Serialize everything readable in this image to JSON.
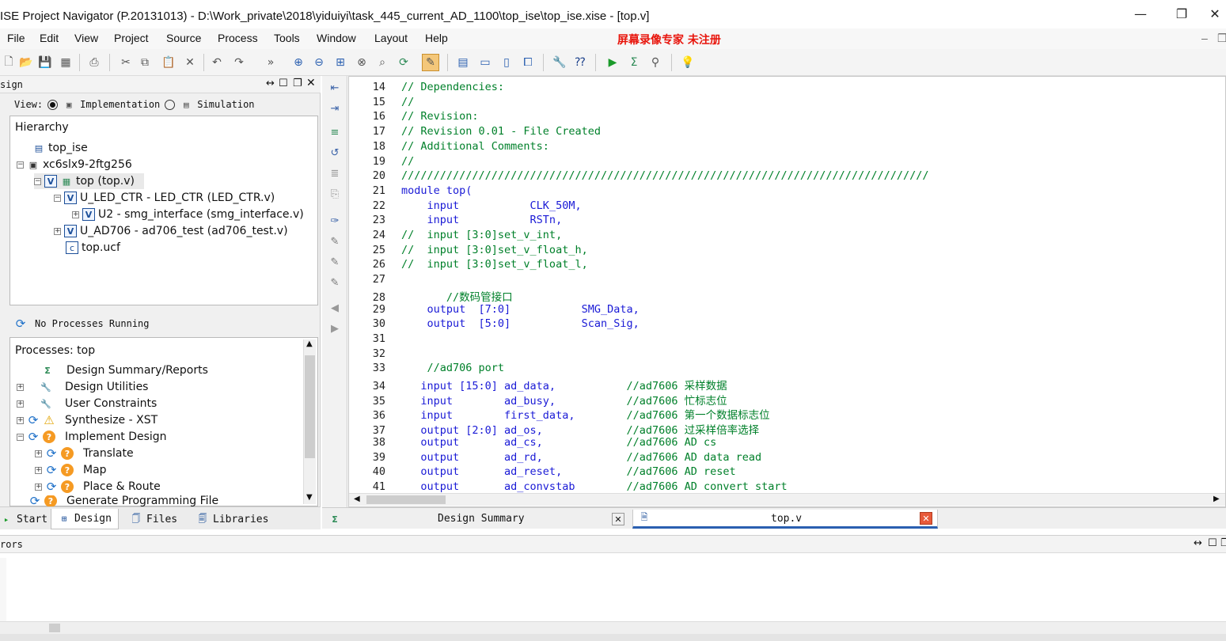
{
  "window": {
    "title": "ISE Project Navigator (P.20131013) - D:\\Work_private\\2018\\yiduiyi\\task_445_current_AD_1100\\top_ise\\top_ise.xise - [top.v]",
    "min": "—",
    "restore": "❐",
    "close": "✕"
  },
  "menu": {
    "items": [
      "File",
      "Edit",
      "View",
      "Project",
      "Source",
      "Process",
      "Tools",
      "Window",
      "Layout",
      "Help"
    ],
    "watermark": "屏幕录像专家  未注册"
  },
  "design_panel": {
    "title": "sign",
    "view_label": "View:",
    "impl_label": "Implementation",
    "sim_label": "Simulation",
    "hierarchy_label": "Hierarchy",
    "tree": [
      "top_ise",
      "xc6slx9-2ftg256",
      "top (top.v)",
      "U_LED_CTR - LED_CTR (LED_CTR.v)",
      "U2 - smg_interface (smg_interface.v)",
      "U_AD706 - ad706_test (ad706_test.v)",
      "top.ucf"
    ],
    "status": "No Processes Running",
    "processes_label": "Processes: top",
    "processes": [
      "Design Summary/Reports",
      "Design Utilities",
      "User Constraints",
      "Synthesize - XST",
      "Implement Design",
      "Translate",
      "Map",
      "Place & Route",
      "Generate Programming File"
    ]
  },
  "left_tabs": [
    "Start",
    "Design",
    "Files",
    "Libraries"
  ],
  "editor": {
    "lines": [
      {
        "n": "14",
        "t": "// Dependencies:"
      },
      {
        "n": "15",
        "t": "//"
      },
      {
        "n": "16",
        "t": "// Revision:"
      },
      {
        "n": "17",
        "t": "// Revision 0.01 - File Created"
      },
      {
        "n": "18",
        "t": "// Additional Comments:"
      },
      {
        "n": "19",
        "t": "//"
      },
      {
        "n": "20",
        "t": "//////////////////////////////////////////////////////////////////////////////////"
      },
      {
        "n": "21",
        "t": "module top("
      },
      {
        "n": "22",
        "t": "    input           CLK_50M,"
      },
      {
        "n": "23",
        "t": "    input           RSTn,"
      },
      {
        "n": "24",
        "t": "//  input [3:0]set_v_int,"
      },
      {
        "n": "25",
        "t": "//  input [3:0]set_v_float_h,"
      },
      {
        "n": "26",
        "t": "//  input [3:0]set_v_float_l,"
      },
      {
        "n": "27",
        "t": ""
      },
      {
        "n": "28",
        "t": "       //数码管接口"
      },
      {
        "n": "29",
        "t": "    output  [7:0]           SMG_Data,"
      },
      {
        "n": "30",
        "t": "    output  [5:0]           Scan_Sig,"
      },
      {
        "n": "31",
        "t": ""
      },
      {
        "n": "32",
        "t": ""
      },
      {
        "n": "33",
        "t": "    //ad706 port"
      },
      {
        "n": "34",
        "t": "   input [15:0] ad_data,           //ad7606 采样数据"
      },
      {
        "n": "35",
        "t": "   input        ad_busy,           //ad7606 忙标志位"
      },
      {
        "n": "36",
        "t": "   input        first_data,        //ad7606 第一个数据标志位"
      },
      {
        "n": "37",
        "t": "   output [2:0] ad_os,             //ad7606 过采样倍率选择"
      },
      {
        "n": "38",
        "t": "   output       ad_cs,             //ad7606 AD cs"
      },
      {
        "n": "39",
        "t": "   output       ad_rd,             //ad7606 AD data read"
      },
      {
        "n": "40",
        "t": "   output       ad_reset,          //ad7606 AD reset"
      },
      {
        "n": "41",
        "t": "   output       ad_convstab        //ad7606 AD convert start"
      }
    ]
  },
  "editor_tabs": {
    "summary": "Design Summary",
    "topv": "top.v"
  },
  "errors_panel": {
    "title": "rors"
  }
}
